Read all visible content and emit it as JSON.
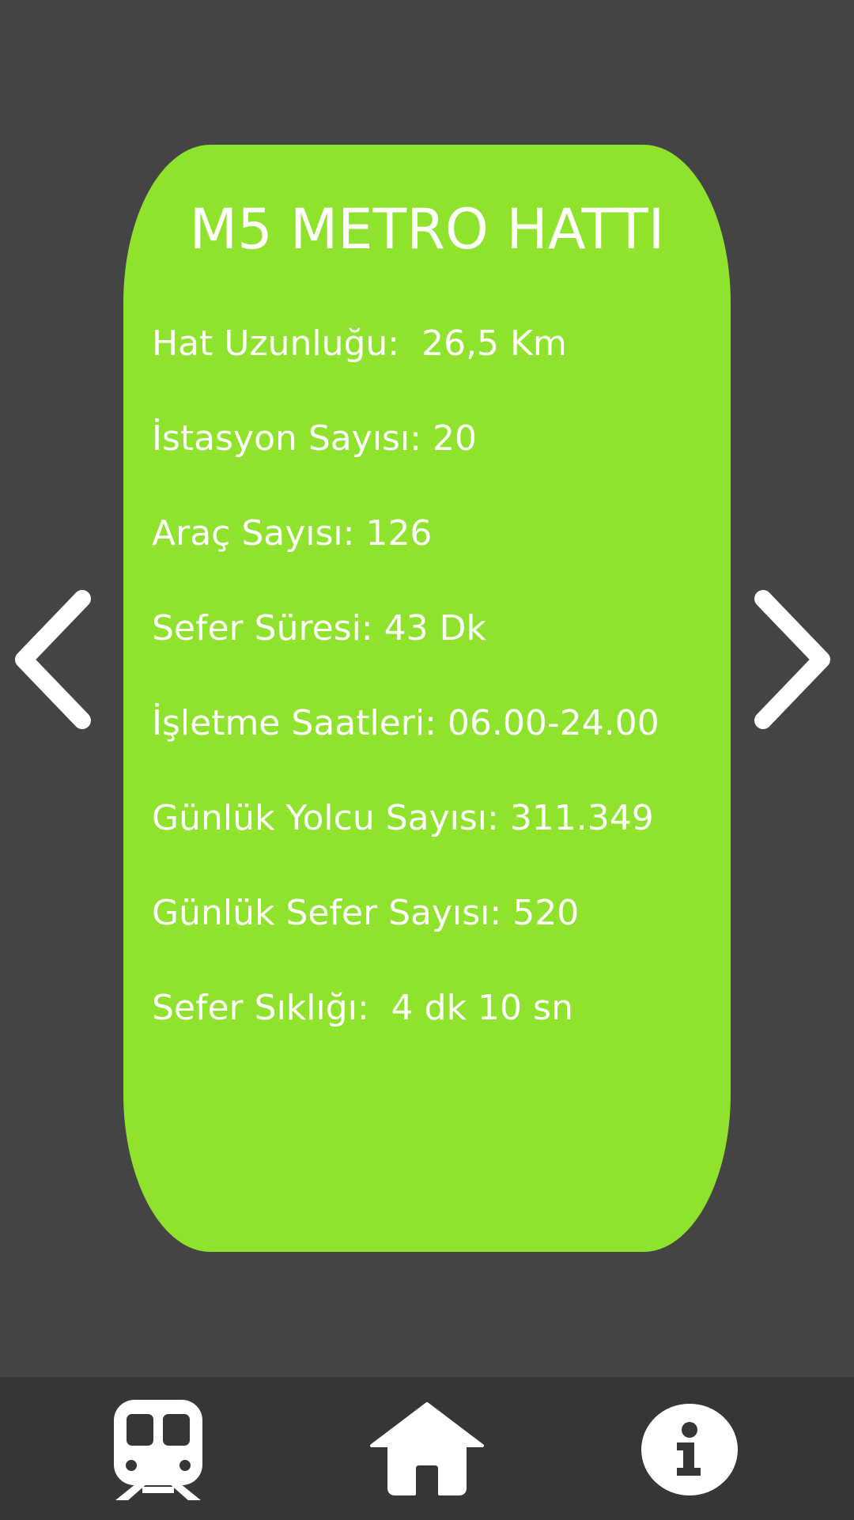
{
  "card": {
    "title": "M5 METRO HATTI",
    "stats": [
      "Hat Uzunluğu:  26,5 Km",
      "İstasyon Sayısı: 20",
      "Araç Sayısı: 126",
      "Sefer Süresi: 43 Dk",
      "İşletme Saatleri: 06.00-24.00",
      "Günlük Yolcu Sayısı: 311.349",
      "Günlük Sefer Sayısı: 520",
      "Sefer Sıklığı:  4 dk 10 sn"
    ],
    "color": "#8fe32d"
  },
  "colors": {
    "background": "#444444",
    "bottom_bar": "#363636",
    "foreground": "#ffffff"
  },
  "nav": {
    "previous_icon": "chevron-left-icon",
    "next_icon": "chevron-right-icon"
  },
  "bottom_bar": {
    "items": [
      {
        "icon": "train-icon"
      },
      {
        "icon": "home-icon"
      },
      {
        "icon": "info-icon"
      }
    ]
  }
}
